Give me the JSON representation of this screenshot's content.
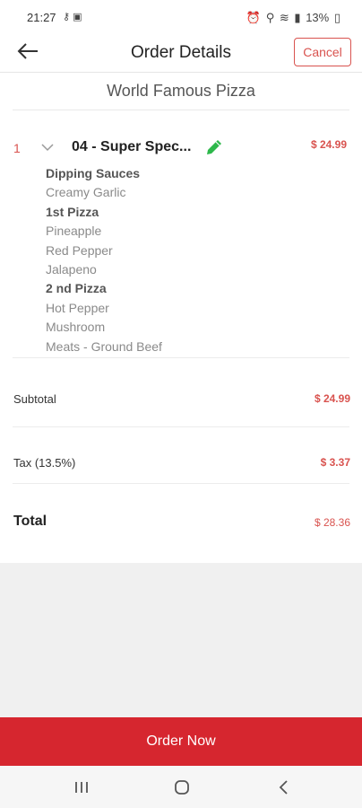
{
  "status_bar": {
    "time": "21:27",
    "battery": "13%",
    "icons_left": [
      "vpn-key-icon",
      "sim-icon"
    ],
    "icons_right": [
      "alarm-icon",
      "location-icon",
      "wifi-icon",
      "signal-icon",
      "battery-icon"
    ]
  },
  "header": {
    "title": "Order Details",
    "cancel_label": "Cancel"
  },
  "restaurant": {
    "name": "World Famous Pizza"
  },
  "order_item": {
    "quantity": "1",
    "name": "04 - Super Spec...",
    "price": "$ 24.99",
    "modifiers": [
      {
        "text": "Dipping Sauces",
        "heading": true
      },
      {
        "text": "Creamy Garlic",
        "heading": false
      },
      {
        "text": "1st Pizza",
        "heading": true
      },
      {
        "text": "Pineapple",
        "heading": false
      },
      {
        "text": "Red Pepper",
        "heading": false
      },
      {
        "text": "Jalapeno",
        "heading": false
      },
      {
        "text": "2 nd Pizza",
        "heading": true
      },
      {
        "text": "Hot Pepper",
        "heading": false
      },
      {
        "text": "Mushroom",
        "heading": false
      },
      {
        "text": "Meats - Ground Beef",
        "heading": false
      }
    ]
  },
  "summary": {
    "subtotal_label": "Subtotal",
    "subtotal_value": "$ 24.99",
    "tax_label": "Tax (13.5%)",
    "tax_value": "$ 3.37",
    "total_label": "Total",
    "total_value": "$ 28.36"
  },
  "footer": {
    "order_button_label": "Order Now"
  },
  "colors": {
    "accent": "#d6262f",
    "price": "#d9534f",
    "edit_icon": "#2db84b"
  }
}
